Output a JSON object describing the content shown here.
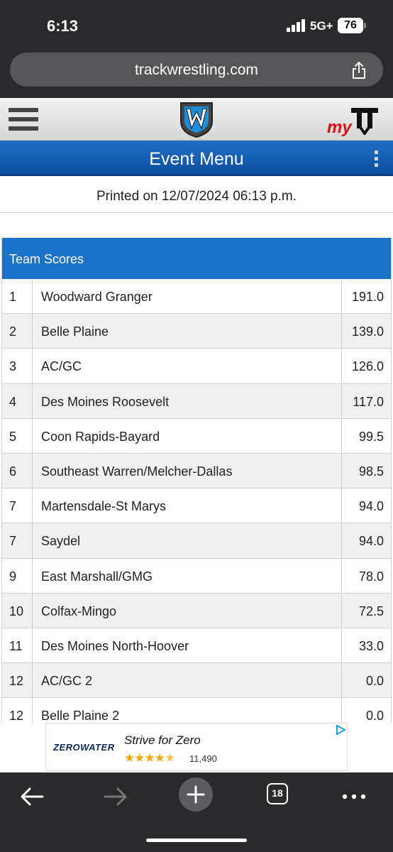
{
  "status_bar": {
    "time": "6:13",
    "network": "5G+",
    "battery": "76"
  },
  "address_bar": {
    "url": "trackwrestling.com"
  },
  "header": {
    "my_logo_text": "my"
  },
  "event_menu": {
    "title": "Event Menu"
  },
  "printed_on": "Printed on 12/07/2024 06:13 p.m.",
  "team_scores": {
    "title": "Team Scores",
    "rows": [
      {
        "rank": "1",
        "team": "Woodward Granger",
        "points": "191.0"
      },
      {
        "rank": "2",
        "team": "Belle Plaine",
        "points": "139.0"
      },
      {
        "rank": "3",
        "team": "AC/GC",
        "points": "126.0"
      },
      {
        "rank": "4",
        "team": "Des Moines Roosevelt",
        "points": "117.0"
      },
      {
        "rank": "5",
        "team": "Coon Rapids-Bayard",
        "points": "99.5"
      },
      {
        "rank": "6",
        "team": "Southeast Warren/Melcher-Dallas",
        "points": "98.5"
      },
      {
        "rank": "7",
        "team": "Martensdale-St Marys",
        "points": "94.0"
      },
      {
        "rank": "7",
        "team": "Saydel",
        "points": "94.0"
      },
      {
        "rank": "9",
        "team": "East Marshall/GMG",
        "points": "78.0"
      },
      {
        "rank": "10",
        "team": "Colfax-Mingo",
        "points": "72.5"
      },
      {
        "rank": "11",
        "team": "Des Moines North-Hoover",
        "points": "33.0"
      },
      {
        "rank": "12",
        "team": "AC/GC 2",
        "points": "0.0"
      },
      {
        "rank": "12",
        "team": "Belle Plaine 2",
        "points": "0.0"
      }
    ]
  },
  "ad": {
    "brand": "ZEROWATER",
    "title": "Strive for Zero",
    "rating": 4.5,
    "rating_count": "11,490"
  },
  "toolbar": {
    "tab_count": "18"
  },
  "colors": {
    "accent_blue": "#1b72c9",
    "menu_blue": "#0d4f9e",
    "brand_red": "#e01010",
    "chrome_dark": "#2a2a2c"
  }
}
